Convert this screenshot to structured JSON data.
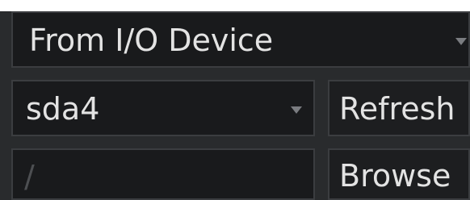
{
  "source_select": {
    "value": "From I/O Device",
    "icon": "caret-down-icon"
  },
  "device_select": {
    "value": "sda4",
    "icon": "caret-down-icon"
  },
  "path_field": {
    "value": "/"
  },
  "buttons": {
    "refresh_label": "Refresh",
    "browse_label": "Browse"
  },
  "colors": {
    "panel_bg": "#292b2d",
    "field_bg": "#191a1c",
    "border": "#3b3d40",
    "text": "#e3e3e3",
    "caret": "#7a7c80"
  }
}
